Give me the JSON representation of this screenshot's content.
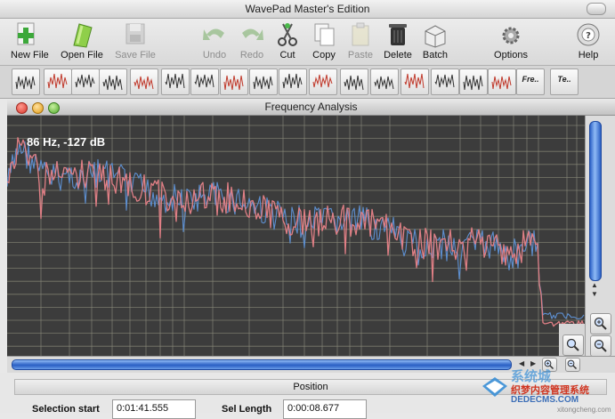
{
  "app": {
    "title": "WavePad Master's Edition"
  },
  "toolbar": {
    "items": [
      {
        "label": "New File",
        "enabled": true
      },
      {
        "label": "Open File",
        "enabled": true
      },
      {
        "label": "Save File",
        "enabled": false
      },
      {
        "label": "Undo",
        "enabled": false
      },
      {
        "label": "Redo",
        "enabled": false
      },
      {
        "label": "Cut",
        "enabled": true
      },
      {
        "label": "Copy",
        "enabled": true
      },
      {
        "label": "Paste",
        "enabled": false
      },
      {
        "label": "Delete",
        "enabled": true
      },
      {
        "label": "Batch",
        "enabled": true
      },
      {
        "label": "Options",
        "enabled": true
      },
      {
        "label": "Help",
        "enabled": true
      }
    ]
  },
  "effects": {
    "text_buttons": [
      "Fre..",
      "Te.."
    ]
  },
  "window": {
    "title": "Frequency Analysis",
    "readout": "86 Hz, -127 dB"
  },
  "colors": {
    "trace_a": "#e07f85",
    "trace_b": "#5d8fd0",
    "plot_bg": "#3c3c3c",
    "grid": "#8a8a7a"
  },
  "position": {
    "header": "Position",
    "selection_start_label": "Selection start",
    "selection_start_value": "0:01:41.555",
    "sel_length_label": "Sel Length",
    "sel_length_value": "0:00:08.677"
  },
  "watermark": {
    "site": "系统城",
    "line1": "织梦内容管理系统",
    "line2": "DEDECMS.COM",
    "line3": "xitongcheng.com"
  }
}
